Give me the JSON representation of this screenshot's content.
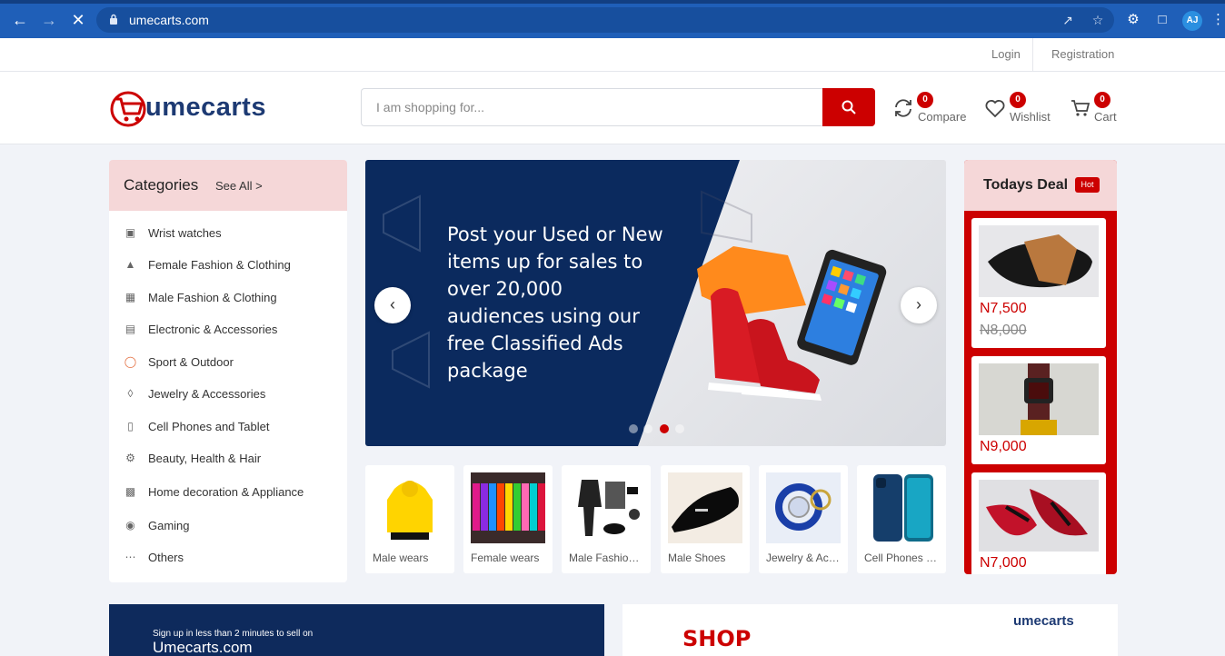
{
  "browser": {
    "url": "umecarts.com",
    "profile_initials": "AJ"
  },
  "topbar": {
    "login_label": "Login",
    "registration_label": "Registration"
  },
  "header": {
    "logo_text": "umecarts",
    "search_placeholder": "I am shopping for...",
    "compare": {
      "label": "Compare",
      "count": "0"
    },
    "wishlist": {
      "label": "Wishlist",
      "count": "0"
    },
    "cart": {
      "label": "Cart",
      "count": "0"
    }
  },
  "categories": {
    "title": "Categories",
    "see_all": "See All >",
    "items": [
      {
        "label": "Wrist watches",
        "icon": "watch-icon"
      },
      {
        "label": "Female Fashion & Clothing",
        "icon": "dress-icon"
      },
      {
        "label": "Male Fashion & Clothing",
        "icon": "shirt-icon"
      },
      {
        "label": "Electronic & Accessories",
        "icon": "electronics-icon"
      },
      {
        "label": "Sport & Outdoor",
        "icon": "ball-icon"
      },
      {
        "label": "Jewelry & Accessories",
        "icon": "jewelry-icon"
      },
      {
        "label": "Cell Phones and Tablet",
        "icon": "phone-icon"
      },
      {
        "label": "Beauty, Health & Hair",
        "icon": "beauty-icon"
      },
      {
        "label": "Home decoration & Appliance",
        "icon": "appliance-icon"
      },
      {
        "label": "Gaming",
        "icon": "gamepad-icon"
      },
      {
        "label": "Others",
        "icon": "more-icon"
      }
    ]
  },
  "banner": {
    "text": "Post your Used or New items up for sales to over 20,000 audiences using our free Classified Ads package",
    "slides": 4,
    "active_slide": 3
  },
  "featured": [
    {
      "label": "Male wears"
    },
    {
      "label": "Female wears"
    },
    {
      "label": "Male Fashion & Clothing"
    },
    {
      "label": "Male Shoes"
    },
    {
      "label": "Jewelry & Accessories"
    },
    {
      "label": "Cell Phones and Tablet"
    }
  ],
  "todays_deal": {
    "title": "Todays Deal",
    "badge": "Hot",
    "items": [
      {
        "price": "N7,500",
        "old_price": "N8,000"
      },
      {
        "price": "N9,000"
      },
      {
        "price": "N7,000"
      }
    ]
  },
  "promo": {
    "left_small": "Sign up in less than 2 minutes to sell on",
    "left_big": "Umecarts.com",
    "right_shop": "SHOP",
    "right_logo": "umecarts"
  },
  "colors": {
    "brand_red": "#cc0000",
    "brand_navy": "#1d3a73",
    "browser_blue": "#1f5fb8"
  }
}
